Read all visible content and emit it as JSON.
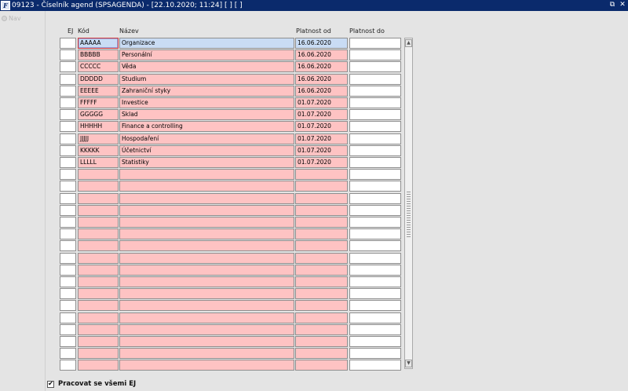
{
  "window": {
    "title": "09123 - Číselník agend (SPSAGENDA) - [22.10.2020; 11:24]  [ ]  [ ]",
    "icon": "app-logo-icon",
    "icon_glyph": "F",
    "restore_glyph": "⧉",
    "close_glyph": "✕"
  },
  "nav": {
    "label": "Nav"
  },
  "table": {
    "columns": {
      "ej": "EJ",
      "kod": "Kód",
      "nazev": "Název",
      "platnost_od": "Platnost od",
      "platnost_do": "Platnost do"
    },
    "rows": [
      {
        "ej": "",
        "kod": "AAAAA",
        "nazev": "Organizace",
        "od": "16.06.2020",
        "do": ""
      },
      {
        "ej": "",
        "kod": "BBBBB",
        "nazev": "Personální",
        "od": "16.06.2020",
        "do": ""
      },
      {
        "ej": "",
        "kod": "CCCCC",
        "nazev": "Věda",
        "od": "16.06.2020",
        "do": ""
      },
      {
        "ej": "",
        "kod": "DDDDD",
        "nazev": "Studium",
        "od": "16.06.2020",
        "do": ""
      },
      {
        "ej": "",
        "kod": "EEEEE",
        "nazev": "Zahraniční styky",
        "od": "16.06.2020",
        "do": ""
      },
      {
        "ej": "",
        "kod": "FFFFF",
        "nazev": "Investice",
        "od": "01.07.2020",
        "do": ""
      },
      {
        "ej": "",
        "kod": "GGGGG",
        "nazev": "Sklad",
        "od": "01.07.2020",
        "do": ""
      },
      {
        "ej": "",
        "kod": "HHHHH",
        "nazev": "Finance a controlling",
        "od": "01.07.2020",
        "do": ""
      },
      {
        "ej": "",
        "kod": "JJJJJ",
        "nazev": "Hospodaření",
        "od": "01.07.2020",
        "do": ""
      },
      {
        "ej": "",
        "kod": "KKKKK",
        "nazev": "Účetnictví",
        "od": "01.07.2020",
        "do": ""
      },
      {
        "ej": "",
        "kod": "LLLLL",
        "nazev": "Statistiky",
        "od": "01.07.2020",
        "do": ""
      },
      {
        "ej": "",
        "kod": "",
        "nazev": "",
        "od": "",
        "do": ""
      },
      {
        "ej": "",
        "kod": "",
        "nazev": "",
        "od": "",
        "do": ""
      },
      {
        "ej": "",
        "kod": "",
        "nazev": "",
        "od": "",
        "do": ""
      },
      {
        "ej": "",
        "kod": "",
        "nazev": "",
        "od": "",
        "do": ""
      },
      {
        "ej": "",
        "kod": "",
        "nazev": "",
        "od": "",
        "do": ""
      },
      {
        "ej": "",
        "kod": "",
        "nazev": "",
        "od": "",
        "do": ""
      },
      {
        "ej": "",
        "kod": "",
        "nazev": "",
        "od": "",
        "do": ""
      },
      {
        "ej": "",
        "kod": "",
        "nazev": "",
        "od": "",
        "do": ""
      },
      {
        "ej": "",
        "kod": "",
        "nazev": "",
        "od": "",
        "do": ""
      },
      {
        "ej": "",
        "kod": "",
        "nazev": "",
        "od": "",
        "do": ""
      },
      {
        "ej": "",
        "kod": "",
        "nazev": "",
        "od": "",
        "do": ""
      },
      {
        "ej": "",
        "kod": "",
        "nazev": "",
        "od": "",
        "do": ""
      },
      {
        "ej": "",
        "kod": "",
        "nazev": "",
        "od": "",
        "do": ""
      },
      {
        "ej": "",
        "kod": "",
        "nazev": "",
        "od": "",
        "do": ""
      },
      {
        "ej": "",
        "kod": "",
        "nazev": "",
        "od": "",
        "do": ""
      },
      {
        "ej": "",
        "kod": "",
        "nazev": "",
        "od": "",
        "do": ""
      },
      {
        "ej": "",
        "kod": "",
        "nazev": "",
        "od": "",
        "do": ""
      }
    ],
    "selected_row": 0,
    "colors": {
      "row_pink": "#fec3c3",
      "row_selected": "#c9dcf4",
      "title_bar": "#0a2a6c"
    }
  },
  "scrollbar": {
    "up_icon": "scroll-up-arrow-icon",
    "down_icon": "scroll-down-arrow-icon",
    "up_glyph": "▲",
    "down_glyph": "▼"
  },
  "footer": {
    "checkbox_checked": true,
    "checkbox_glyph": "✔",
    "checkbox_label": "Pracovat se všemi EJ"
  }
}
